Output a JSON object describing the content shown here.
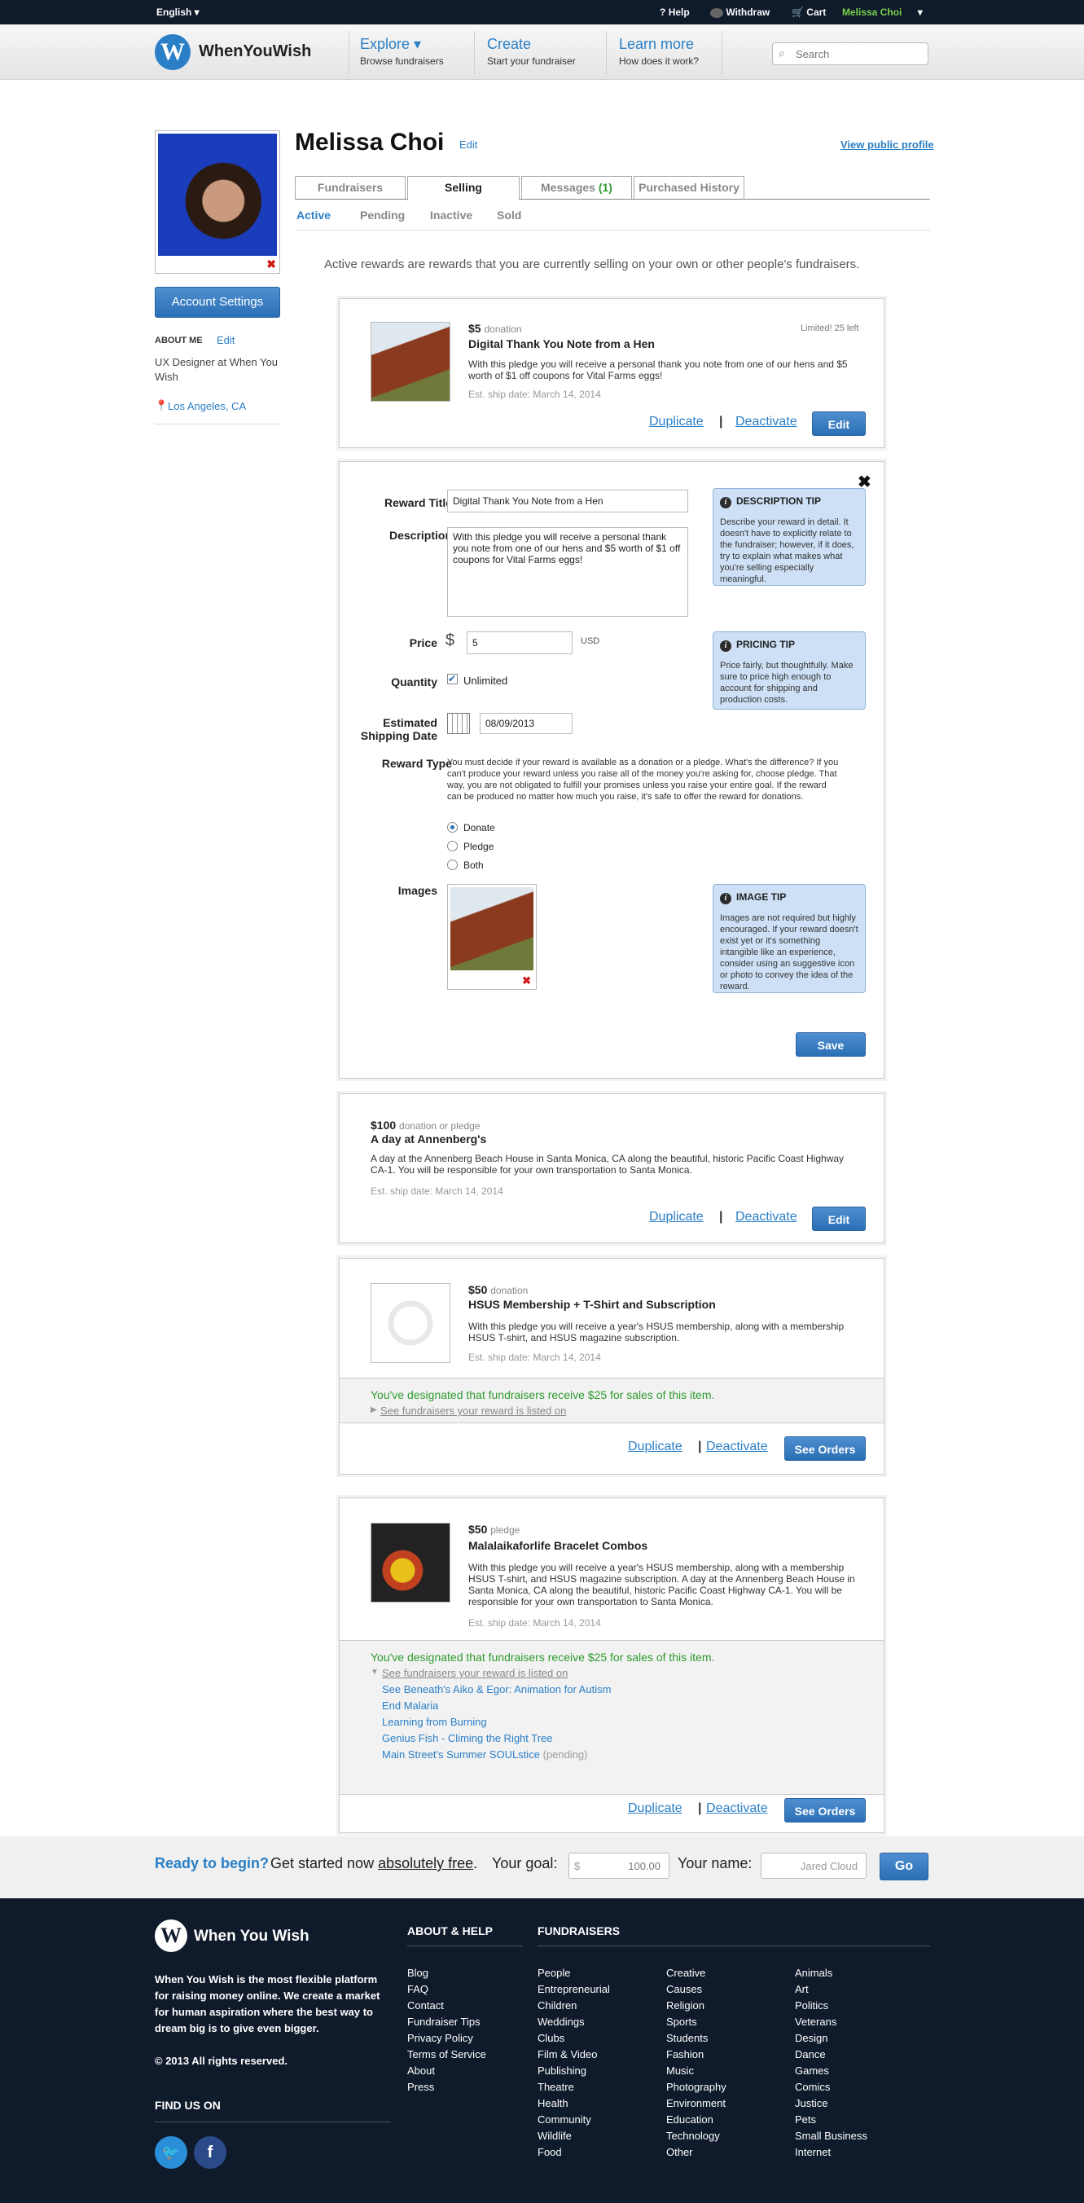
{
  "topbar": {
    "language": "English",
    "help": "Help",
    "withdraw": "Withdraw",
    "cart": "Cart",
    "user": "Melissa Choi"
  },
  "header": {
    "logo_text": "WhenYouWish",
    "logo_letter": "W",
    "nav": [
      {
        "title": "Explore ▾",
        "sub": "Browse fundraisers"
      },
      {
        "title": "Create",
        "sub": "Start your fundraiser"
      },
      {
        "title": "Learn more",
        "sub": "How does it work?"
      }
    ],
    "search_placeholder": "Search"
  },
  "profile": {
    "name": "Melissa Choi",
    "edit": "Edit",
    "view_public": "View public profile",
    "account_settings": "Account Settings",
    "about_me_label": "ABOUT ME",
    "about_edit": "Edit",
    "about_text": "UX Designer at When You Wish",
    "location": "Los Angeles, CA"
  },
  "tabs": [
    "Fundraisers",
    "Selling",
    "Messages",
    "Purchased History"
  ],
  "messages_count": "(1)",
  "subtabs": [
    "Active",
    "Pending",
    "Inactive",
    "Sold"
  ],
  "intro": "Active rewards are rewards that you are currently selling on your own or other people's fundraisers.",
  "actions": {
    "duplicate": "Duplicate",
    "deactivate": "Deactivate",
    "edit": "Edit",
    "see_orders": "See Orders",
    "pipe": "|"
  },
  "reward1": {
    "price": "$5",
    "type": "donation",
    "limit": "Limited! 25 left",
    "title": "Digital Thank You Note from a Hen",
    "desc": "With this pledge you will receive a personal thank you note from one of our hens and $5 worth of $1 off coupons for Vital Farms eggs!",
    "ship": "Est. ship date: March 14, 2014"
  },
  "form": {
    "title_label": "Reward Title",
    "title_value": "Digital Thank You Note from a Hen",
    "desc_label": "Description",
    "desc_value": "With this pledge you will receive a personal thank you note from one of our hens and $5 worth of $1 off coupons for Vital Farms eggs!",
    "price_label": "Price",
    "currency_symbol": "$",
    "price_value": "5",
    "currency": "USD",
    "qty_label": "Quantity",
    "unlimited": "Unlimited",
    "ship_label_1": "Estimated",
    "ship_label_2": "Shipping Date",
    "ship_value": "08/09/2013",
    "type_label": "Reward Type",
    "type_text": "You must decide if your reward is available as a donation or a pledge. What's the difference? If you can't produce your reward unless you raise all of the money you're asking for, choose pledge. That way, you are not obligated to fulfill your promises unless you raise your entire goal. If the reward can be produced no matter how much you raise, it's safe to offer the reward for donations.",
    "options": [
      "Donate",
      "Pledge",
      "Both"
    ],
    "images_label": "Images",
    "save": "Save",
    "close": "✖",
    "tips": [
      {
        "title": "DESCRIPTION TIP",
        "text": "Describe your reward in detail. It doesn't have to explicitly relate to the fundraiser; however, if it does, try to explain what makes what you're selling especially meaningful."
      },
      {
        "title": "PRICING TIP",
        "text": "Price fairly, but thoughtfully. Make sure to price high enough to account for shipping and production costs."
      },
      {
        "title": "IMAGE TIP",
        "text": "Images are not required but highly encouraged. If your reward doesn't exist yet or it's something intangible like an experience, consider using an suggestive icon or photo to convey the idea of the reward."
      }
    ]
  },
  "reward2": {
    "price": "$100",
    "type": "donation or pledge",
    "title": "A day at Annenberg's",
    "desc": "A day at the Annenberg Beach House in Santa Monica, CA along the beautiful, historic Pacific Coast Highway CA-1. You will be responsible for your own transportation to Santa Monica.",
    "ship": "Est. ship date: March 14, 2014"
  },
  "reward3": {
    "price": "$50",
    "type": "donation",
    "title": "HSUS Membership + T-Shirt and Subscription",
    "desc": "With this pledge you will receive a year's HSUS membership, along with a membership HSUS T-shirt, and HSUS magazine subscription.",
    "ship": "Est. ship date: March 14, 2014",
    "designated": "You've designated that fundraisers receive $25 for sales of this item.",
    "see_link": "See fundraisers your reward is listed on"
  },
  "reward4": {
    "price": "$50",
    "type": "pledge",
    "title": "Malalaikaforlife Bracelet Combos",
    "desc": "With this pledge you will receive a year's HSUS membership, along with a membership HSUS T-shirt, and HSUS magazine subscription. A day at the Annenberg Beach House in Santa Monica, CA along the beautiful, historic Pacific Coast Highway CA-1. You will be responsible for your own transportation to Santa Monica.",
    "ship": "Est. ship date: March 14, 2014",
    "designated": "You've designated that fundraisers receive $25 for sales of this item.",
    "see_link": "See fundraisers your reward is listed on",
    "fundraisers": [
      "See Beneath's Aiko & Egor: Animation for Autism",
      "End Malaria",
      "Learning from Burning",
      "Genius Fish - Climing the Right Tree",
      "Main Street's Summer SOULstice"
    ],
    "pending": "(pending)"
  },
  "cta": {
    "ready": "Ready to begin?",
    "started": "Get started now",
    "free": "absolutely free",
    "dot": ".",
    "goal_label": "Your goal:",
    "goal_prefix": "$",
    "goal_value": "100.00",
    "name_label": "Your name:",
    "name_value": "Jared Cloud",
    "go": "Go"
  },
  "footer": {
    "logo_text": "When You Wish",
    "about": "When You Wish is the most flexible platform for raising money online. We create a market for human aspiration where the best way to dream big is to give even bigger.",
    "copyright": "© 2013 All rights reserved.",
    "find_us": "FIND US ON",
    "about_help": "ABOUT & HELP",
    "about_links": [
      "Blog",
      "FAQ",
      "Contact",
      "Fundraiser Tips",
      "Privacy Policy",
      "Terms of Service",
      "About",
      "Press"
    ],
    "fundraisers": "FUNDRAISERS",
    "col1": [
      "People",
      "Entrepreneurial",
      "Children",
      "Weddings",
      "Clubs",
      "Film & Video",
      "Publishing",
      "Theatre",
      "Health",
      "Community",
      "Wildlife",
      "Food"
    ],
    "col2": [
      "Creative",
      "Causes",
      "Religion",
      "Sports",
      "Students",
      "Fashion",
      "Music",
      "Photography",
      "Environment",
      "Education",
      "Technology",
      "Other"
    ],
    "col3": [
      "Animals",
      "Art",
      "Politics",
      "Veterans",
      "Design",
      "Dance",
      "Games",
      "Comics",
      "Justice",
      "Pets",
      "Small Business",
      "Internet"
    ]
  },
  "colors": {
    "brand_blue": "#2a7fc7",
    "navy": "#0f1a2b",
    "green": "#2e9a2e",
    "tip_bg": "#cde0f5"
  }
}
